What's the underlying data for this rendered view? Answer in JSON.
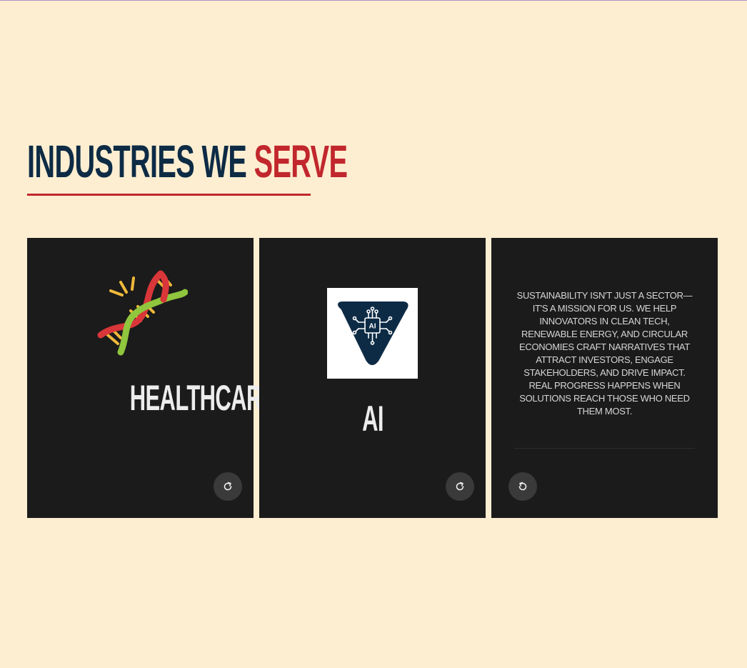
{
  "section": {
    "title_main": "INDUSTRIES WE ",
    "title_accent": "SERVE"
  },
  "colors": {
    "background": "#fdeed1",
    "title_navy": "#0d2b45",
    "accent_red": "#c1272d",
    "card_bg": "#1b1b1b"
  },
  "cards": [
    {
      "title": "HEALTHCARE & LIFE SCIENCES",
      "icon": "dna-icon",
      "button_icon": "flip-forward-icon"
    },
    {
      "title": "AI",
      "icon": "ai-chip-icon",
      "icon_text": "AI",
      "button_icon": "flip-forward-icon"
    },
    {
      "description": "SUSTAINABILITY ISN'T JUST A SECTOR— IT'S A MISSION FOR US. WE HELP INNOVATORS IN CLEAN TECH, RENEWABLE ENERGY, AND CIRCULAR ECONOMIES CRAFT NARRATIVES THAT ATTRACT INVESTORS, ENGAGE STAKEHOLDERS, AND DRIVE IMPACT. REAL PROGRESS HAPPENS WHEN SOLUTIONS REACH THOSE WHO NEED THEM MOST.",
      "button_icon": "flip-back-icon"
    }
  ]
}
